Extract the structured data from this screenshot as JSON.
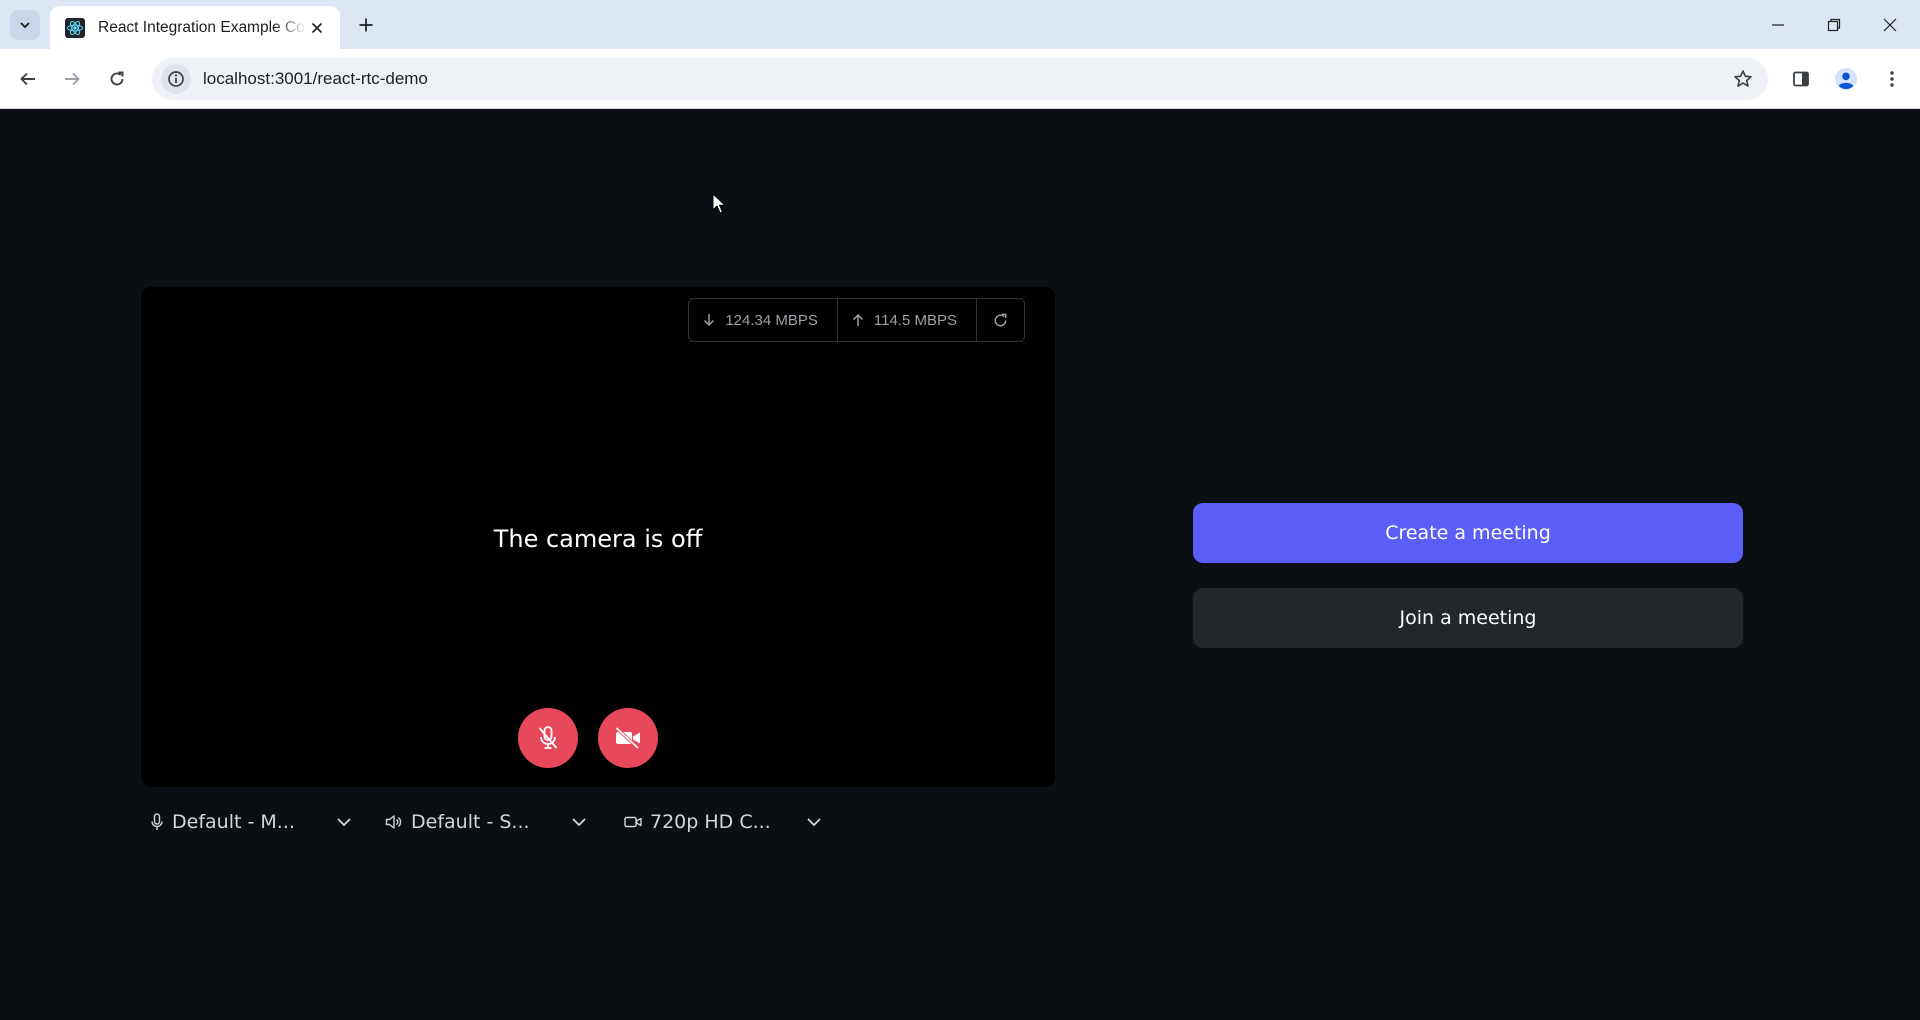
{
  "browser": {
    "tab_title": "React Integration Example Code",
    "url": "localhost:3001/react-rtc-demo"
  },
  "preview": {
    "download_speed": "124.34 MBPS",
    "upload_speed": "114.5 MBPS",
    "camera_status": "The camera is off",
    "mic_muted": true,
    "camera_disabled": true
  },
  "devices": {
    "microphone": "Default - M...",
    "speaker": "Default - S...",
    "camera": "720p HD C..."
  },
  "actions": {
    "create_label": "Create a meeting",
    "join_label": "Join a meeting"
  },
  "colors": {
    "accent": "#5b5ef6",
    "danger": "#e8485c",
    "page_bg": "#0b0f14"
  }
}
